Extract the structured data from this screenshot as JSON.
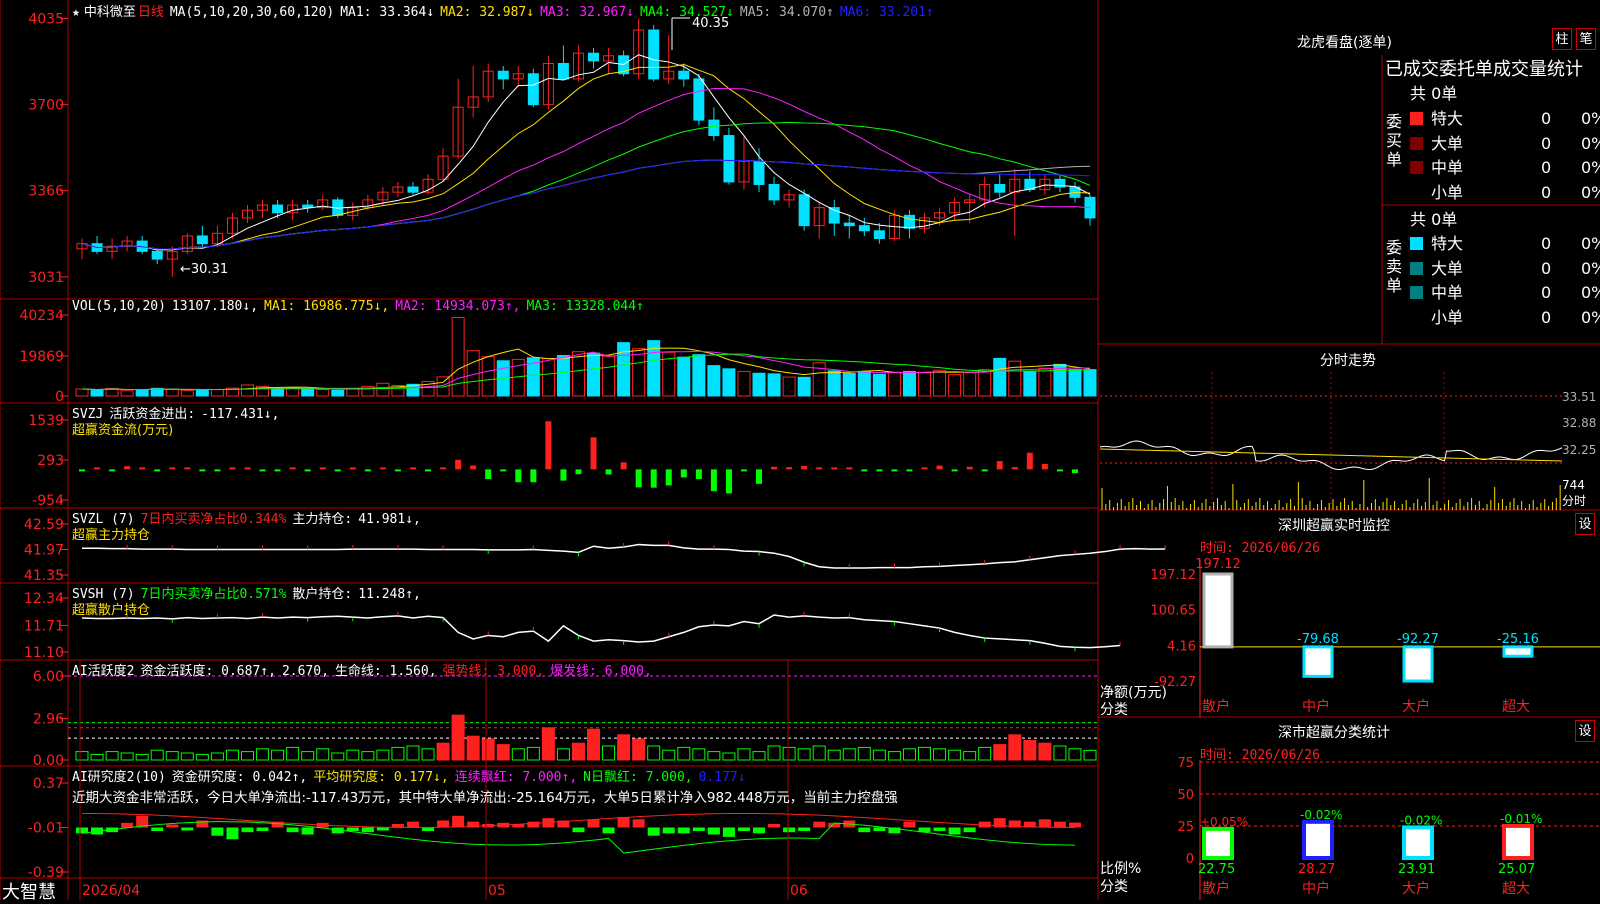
{
  "app": {
    "brand": "大智慧",
    "star_icon": "★"
  },
  "colors": {
    "up": "#ff2020",
    "down": "#00e0ff",
    "grid": "#b00000",
    "yellow": "#ffe000",
    "magenta": "#ff20ff",
    "green": "#00ff00",
    "white": "#ffffff",
    "blue": "#2020ff",
    "grey": "#b0b0b0",
    "dkred": "#800000",
    "dkcyan": "#008080"
  },
  "main": {
    "stock_name": "中科微至",
    "period": "日线",
    "ma_label": "MA(5,10,20,30,60,120)",
    "ma_values": [
      {
        "name": "MA1:",
        "value": "33.364",
        "arrow": "↓",
        "color": "#ffffff"
      },
      {
        "name": "MA2:",
        "value": "32.987",
        "arrow": "↓",
        "color": "#ffe000"
      },
      {
        "name": "MA3:",
        "value": "32.967",
        "arrow": "↓",
        "color": "#ff20ff"
      },
      {
        "name": "MA4:",
        "value": "34.527",
        "arrow": "↓",
        "color": "#00ff00"
      },
      {
        "name": "MA5:",
        "value": "34.070",
        "arrow": "↑",
        "color": "#b0b0b0"
      },
      {
        "name": "MA6:",
        "value": "33.201",
        "arrow": "↑",
        "color": "#2020ff"
      }
    ],
    "yticks": [
      "4035",
      "3700",
      "3366",
      "3031"
    ],
    "high_label": "40.35",
    "low_label": "←30.31"
  },
  "chart_data": [
    {
      "type": "candlestick",
      "title": "中科微至 日线",
      "x_date_labels": [
        "2026/04",
        "05",
        "06"
      ],
      "ylim": [
        29.8,
        40.6
      ],
      "candles": [
        [
          31.4,
          31.8,
          31.0,
          31.6
        ],
        [
          31.6,
          31.9,
          31.2,
          31.3
        ],
        [
          31.3,
          31.8,
          31.0,
          31.5
        ],
        [
          31.5,
          31.9,
          31.3,
          31.7
        ],
        [
          31.7,
          31.9,
          31.2,
          31.3
        ],
        [
          31.3,
          31.4,
          30.8,
          31.0
        ],
        [
          31.0,
          31.5,
          30.31,
          31.3
        ],
        [
          31.3,
          32.0,
          31.2,
          31.9
        ],
        [
          31.9,
          32.3,
          31.4,
          31.6
        ],
        [
          31.6,
          32.3,
          31.5,
          32.0
        ],
        [
          32.0,
          32.8,
          31.8,
          32.6
        ],
        [
          32.6,
          33.1,
          32.4,
          32.9
        ],
        [
          32.9,
          33.3,
          32.6,
          33.1
        ],
        [
          33.1,
          33.3,
          32.6,
          32.8
        ],
        [
          32.8,
          33.3,
          32.5,
          33.1
        ],
        [
          33.1,
          33.3,
          32.8,
          33.0
        ],
        [
          33.0,
          33.5,
          32.9,
          33.3
        ],
        [
          33.3,
          33.4,
          32.6,
          32.7
        ],
        [
          32.7,
          33.2,
          32.5,
          33.0
        ],
        [
          33.0,
          33.5,
          32.9,
          33.3
        ],
        [
          33.3,
          33.8,
          33.1,
          33.6
        ],
        [
          33.6,
          34.0,
          33.4,
          33.8
        ],
        [
          33.8,
          34.0,
          33.5,
          33.6
        ],
        [
          33.6,
          34.3,
          33.5,
          34.1
        ],
        [
          34.1,
          35.3,
          34.0,
          35.0
        ],
        [
          35.0,
          38.0,
          34.9,
          36.9
        ],
        [
          36.9,
          38.5,
          36.5,
          37.3
        ],
        [
          37.3,
          38.6,
          37.1,
          38.3
        ],
        [
          38.3,
          38.5,
          37.6,
          38.0
        ],
        [
          38.0,
          38.5,
          37.7,
          38.2
        ],
        [
          38.2,
          38.4,
          36.9,
          37.0
        ],
        [
          37.0,
          38.9,
          36.8,
          38.6
        ],
        [
          38.6,
          39.3,
          38.0,
          38.0
        ],
        [
          38.0,
          39.3,
          37.9,
          39.0
        ],
        [
          39.0,
          39.2,
          38.4,
          38.7
        ],
        [
          38.7,
          39.2,
          38.2,
          38.9
        ],
        [
          38.9,
          39.1,
          38.1,
          38.2
        ],
        [
          38.2,
          40.35,
          38.0,
          39.9
        ],
        [
          39.9,
          40.1,
          37.9,
          38.0
        ],
        [
          38.0,
          39.7,
          37.8,
          38.3
        ],
        [
          38.3,
          38.6,
          37.7,
          38.0
        ],
        [
          38.0,
          38.2,
          36.2,
          36.4
        ],
        [
          36.4,
          36.9,
          35.6,
          35.8
        ],
        [
          35.8,
          36.1,
          33.9,
          34.0
        ],
        [
          34.0,
          35.8,
          33.7,
          34.8
        ],
        [
          34.8,
          35.3,
          33.6,
          33.9
        ],
        [
          33.9,
          34.2,
          33.1,
          33.3
        ],
        [
          33.3,
          33.7,
          33.0,
          33.5
        ],
        [
          33.5,
          33.7,
          32.1,
          32.3
        ],
        [
          32.3,
          33.2,
          31.8,
          33.0
        ],
        [
          33.0,
          33.3,
          31.9,
          32.4
        ],
        [
          32.4,
          32.7,
          31.8,
          32.3
        ],
        [
          32.3,
          32.6,
          31.9,
          32.1
        ],
        [
          32.1,
          32.4,
          31.6,
          31.8
        ],
        [
          31.8,
          32.9,
          31.7,
          32.7
        ],
        [
          32.7,
          32.9,
          31.8,
          32.2
        ],
        [
          32.2,
          32.8,
          32.0,
          32.6
        ],
        [
          32.6,
          33.0,
          32.3,
          32.8
        ],
        [
          32.8,
          33.4,
          32.5,
          33.2
        ],
        [
          33.2,
          33.5,
          32.4,
          33.3
        ],
        [
          33.3,
          34.2,
          33.0,
          33.9
        ],
        [
          33.9,
          34.3,
          33.4,
          33.6
        ],
        [
          33.6,
          34.5,
          31.9,
          34.1
        ],
        [
          34.1,
          34.4,
          33.6,
          33.7
        ],
        [
          33.7,
          34.3,
          33.5,
          34.1
        ],
        [
          34.1,
          34.3,
          33.6,
          33.8
        ],
        [
          33.8,
          34.0,
          33.2,
          33.4
        ],
        [
          33.4,
          33.5,
          32.3,
          32.6
        ]
      ]
    },
    {
      "type": "bar",
      "title": "VOL(5,10,20)",
      "ylim": [
        0,
        40234
      ],
      "yticks": [
        "40234",
        "19869",
        "0"
      ],
      "legend": [
        {
          "text": "13107.180↓,",
          "color": "#ffffff"
        },
        {
          "text": "MA1: 16986.775↓,",
          "color": "#ffe000"
        },
        {
          "text": "MA2: 14934.073↑,",
          "color": "#ff20ff"
        },
        {
          "text": "MA3: 13328.044↑",
          "color": "#00ff00"
        }
      ],
      "values": [
        3500,
        3000,
        3800,
        2600,
        3200,
        3800,
        3400,
        2800,
        3000,
        3200,
        3900,
        5500,
        4800,
        3600,
        4100,
        3700,
        3200,
        2800,
        3600,
        4800,
        6300,
        5200,
        5800,
        7200,
        9500,
        39000,
        22500,
        19500,
        17500,
        18200,
        19000,
        18500,
        20100,
        22000,
        21300,
        19700,
        26500,
        23500,
        27500,
        21700,
        19300,
        20500,
        15100,
        13500,
        12200,
        11300,
        11000,
        9400,
        9300,
        16500,
        12500,
        11200,
        12200,
        10800,
        11800,
        12200,
        11600,
        12800,
        10600,
        11700,
        13100,
        18700,
        17300,
        12100,
        13800,
        15700,
        13100,
        13107
      ]
    },
    {
      "type": "bar",
      "title": "SVZJ",
      "ylim": [
        -954,
        1539
      ],
      "yticks": [
        "1539",
        "293",
        "-954"
      ],
      "legend_title": "活跃资金进出:",
      "legend_value": "-117.431↓,",
      "subtitle": "超赢资金流(万元)",
      "values": [
        -40,
        20,
        -40,
        100,
        40,
        -40,
        40,
        40,
        -30,
        -40,
        60,
        40,
        -50,
        -40,
        40,
        -40,
        40,
        -40,
        40,
        -30,
        50,
        -50,
        40,
        -40,
        40,
        300,
        120,
        -300,
        -50,
        -400,
        -400,
        1500,
        -350,
        -150,
        1000,
        -160,
        220,
        -560,
        -570,
        -500,
        -250,
        -300,
        -680,
        -750,
        -60,
        -450,
        80,
        70,
        110,
        60,
        50,
        40,
        -40,
        -40,
        -40,
        -60,
        40,
        120,
        -40,
        80,
        -40,
        260,
        70,
        520,
        170,
        -50,
        -117
      ]
    },
    {
      "type": "line",
      "title": "SVZL (7)",
      "legend_red": "7日内买卖净占比0.344%",
      "legend_main": "主力持仓:",
      "legend_value": "41.981↓,",
      "subtitle": "超赢主力持仓",
      "ylim": [
        41.35,
        42.59
      ],
      "yticks": [
        "42.59",
        "41.97",
        "41.35"
      ],
      "values": [
        42.0,
        42.0,
        41.99,
        41.99,
        41.98,
        41.98,
        41.98,
        41.97,
        41.97,
        41.97,
        41.97,
        41.97,
        41.97,
        41.97,
        41.97,
        41.97,
        41.97,
        41.97,
        41.98,
        41.98,
        41.98,
        41.98,
        41.98,
        41.97,
        41.97,
        41.97,
        41.97,
        41.96,
        41.96,
        41.96,
        41.97,
        41.95,
        41.93,
        41.9,
        42.05,
        42.0,
        42.03,
        42.09,
        42.07,
        42.07,
        42.01,
        41.98,
        41.98,
        41.97,
        41.93,
        41.92,
        41.88,
        41.8,
        41.66,
        41.55,
        41.52,
        41.52,
        41.52,
        41.53,
        41.53,
        41.53,
        41.55,
        41.56,
        41.58,
        41.6,
        41.62,
        41.65,
        41.67,
        41.72,
        41.77,
        41.82,
        41.85,
        41.88,
        41.92,
        41.98,
        41.99,
        41.98,
        41.981
      ]
    },
    {
      "type": "line",
      "title": "SVSH (7)",
      "legend_green": "7日内买卖净占比0.571%",
      "legend_main": "散户持仓:",
      "legend_value": "11.248↑,",
      "subtitle": "超赢散户持仓",
      "ylim": [
        11.1,
        12.34
      ],
      "yticks": [
        "12.34",
        "11.71",
        "11.10"
      ],
      "values": [
        11.88,
        11.87,
        11.87,
        11.88,
        11.87,
        11.88,
        11.86,
        11.89,
        11.87,
        11.88,
        11.89,
        11.87,
        11.9,
        11.88,
        11.9,
        11.89,
        11.91,
        11.92,
        11.9,
        11.88,
        11.91,
        11.93,
        11.88,
        11.92,
        11.89,
        11.55,
        11.4,
        11.48,
        11.45,
        11.55,
        11.58,
        11.35,
        11.7,
        11.48,
        11.35,
        11.38,
        11.36,
        11.33,
        11.35,
        11.45,
        11.55,
        11.68,
        11.72,
        11.7,
        11.8,
        11.75,
        11.95,
        11.9,
        11.93,
        11.9,
        11.88,
        11.89,
        11.84,
        11.82,
        11.8,
        11.75,
        11.7,
        11.65,
        11.55,
        11.48,
        11.42,
        11.4,
        11.38,
        11.36,
        11.3,
        11.23,
        11.21,
        11.2,
        11.22,
        11.248
      ]
    },
    {
      "type": "bar",
      "title": "AI活跃度2",
      "ylim": [
        0,
        6.0
      ],
      "yticks": [
        "6.00",
        "2.96",
        "0.00"
      ],
      "legend": [
        {
          "text": "资金活跃度: 0.687↑,",
          "color": "#ffffff"
        },
        {
          "text": "2.670,",
          "color": "#ffffff"
        },
        {
          "text": "生命线: 1.560,",
          "color": "#ffffff"
        },
        {
          "text": "强势线: 3.000,",
          "color": "#ff2020"
        },
        {
          "text": "爆发线: 6.000,",
          "color": "#ff20ff"
        }
      ],
      "values": [
        0.6,
        0.4,
        0.6,
        0.5,
        0.4,
        0.7,
        0.6,
        0.5,
        0.4,
        0.5,
        0.7,
        0.6,
        0.8,
        0.7,
        0.9,
        0.6,
        0.8,
        0.5,
        0.7,
        0.6,
        0.7,
        0.9,
        1.0,
        0.8,
        1.2,
        3.2,
        1.7,
        1.5,
        1.1,
        0.8,
        0.9,
        2.3,
        0.8,
        1.2,
        2.2,
        1.0,
        1.8,
        1.5,
        1.0,
        0.7,
        0.9,
        0.8,
        0.6,
        0.5,
        0.8,
        0.6,
        1.0,
        0.9,
        0.8,
        1.0,
        0.7,
        0.8,
        0.9,
        0.7,
        0.6,
        0.8,
        0.9,
        0.8,
        0.7,
        0.6,
        0.9,
        1.1,
        1.8,
        1.4,
        1.2,
        1.0,
        0.8,
        0.687
      ]
    },
    {
      "type": "bar",
      "title": "AI研究度2(10)",
      "ylim": [
        -0.39,
        0.37
      ],
      "yticks": [
        "0.37",
        "-0.01",
        "-0.39"
      ],
      "legend": [
        {
          "text": "资金研究度: 0.042↑,",
          "color": "#ffffff"
        },
        {
          "text": "平均研究度: 0.177↓,",
          "color": "#ffe000"
        },
        {
          "text": "连续飘红: 7.000↑,",
          "color": "#ff20ff"
        },
        {
          "text": "N日飘红: 7.000,",
          "color": "#00ff00"
        },
        {
          "text": "0.177↓",
          "color": "#2020ff"
        }
      ],
      "comment": "近期大资金非常活跃，今日大单净流出:-117.43万元，其中特大单净流出:-25.164万元，大单5日累计净入982.448万元，当前主力控盘强",
      "values": [
        -0.05,
        -0.06,
        -0.04,
        0.04,
        0.1,
        -0.03,
        0.02,
        -0.02,
        0.06,
        -0.07,
        -0.1,
        -0.04,
        -0.03,
        0.05,
        -0.04,
        -0.06,
        0.04,
        -0.05,
        -0.03,
        -0.04,
        -0.02,
        0.03,
        0.05,
        -0.03,
        0.06,
        0.1,
        0.05,
        0.03,
        0.04,
        0.03,
        0.05,
        0.08,
        0.06,
        -0.04,
        0.07,
        -0.05,
        0.09,
        0.07,
        -0.07,
        -0.05,
        -0.05,
        -0.03,
        -0.06,
        -0.08,
        -0.03,
        -0.05,
        0.03,
        -0.04,
        -0.03,
        0.05,
        0.04,
        0.06,
        -0.04,
        -0.03,
        -0.05,
        0.05,
        -0.04,
        -0.03,
        -0.06,
        -0.04,
        0.05,
        0.08,
        0.06,
        0.05,
        0.07,
        0.05,
        0.042
      ]
    },
    {
      "type": "line",
      "title": "分时走势",
      "yticks": [
        "33.51",
        "32.88",
        "32.25"
      ],
      "vol_tick": "744",
      "vol_label": "分时"
    },
    {
      "type": "bar",
      "title": "深圳超赢实时监控",
      "date": "时间: 2026/06/26",
      "yticks": [
        "197.12",
        "100.65",
        "4.16",
        "-92.27"
      ],
      "ylabel": "净额(万元)",
      "xlabel": "分类",
      "categories": [
        "散户",
        "中户",
        "大户",
        "超大"
      ],
      "values": [
        197.12,
        -79.68,
        -92.27,
        -25.16
      ],
      "value_labels": [
        "197.12",
        "-79.68",
        "-92.27",
        "-25.16"
      ]
    },
    {
      "type": "bar",
      "title": "深市超赢分类统计",
      "date": "时间: 2026/06/26",
      "yticks": [
        "75",
        "50",
        "25",
        "0"
      ],
      "ylabel": "比例%",
      "xlabel": "分类",
      "categories": [
        "散户",
        "中户",
        "大户",
        "超大"
      ],
      "values": [
        22.75,
        28.27,
        23.91,
        25.07
      ],
      "changes": [
        "+0.05%",
        "-0.02%",
        "-0.02%",
        "-0.01%"
      ]
    }
  ],
  "side": {
    "title": "龙虎看盘(逐单)",
    "btn_col": "柱",
    "btn_bi": "笔",
    "header": "已成交委托单成交量统计",
    "buy_group": "委买单",
    "sell_group": "委卖单",
    "total": "共 0单",
    "rows": [
      "特大",
      "大单",
      "中单",
      "小单"
    ],
    "zero": "0",
    "pct": "0%",
    "set_btn": "设"
  }
}
